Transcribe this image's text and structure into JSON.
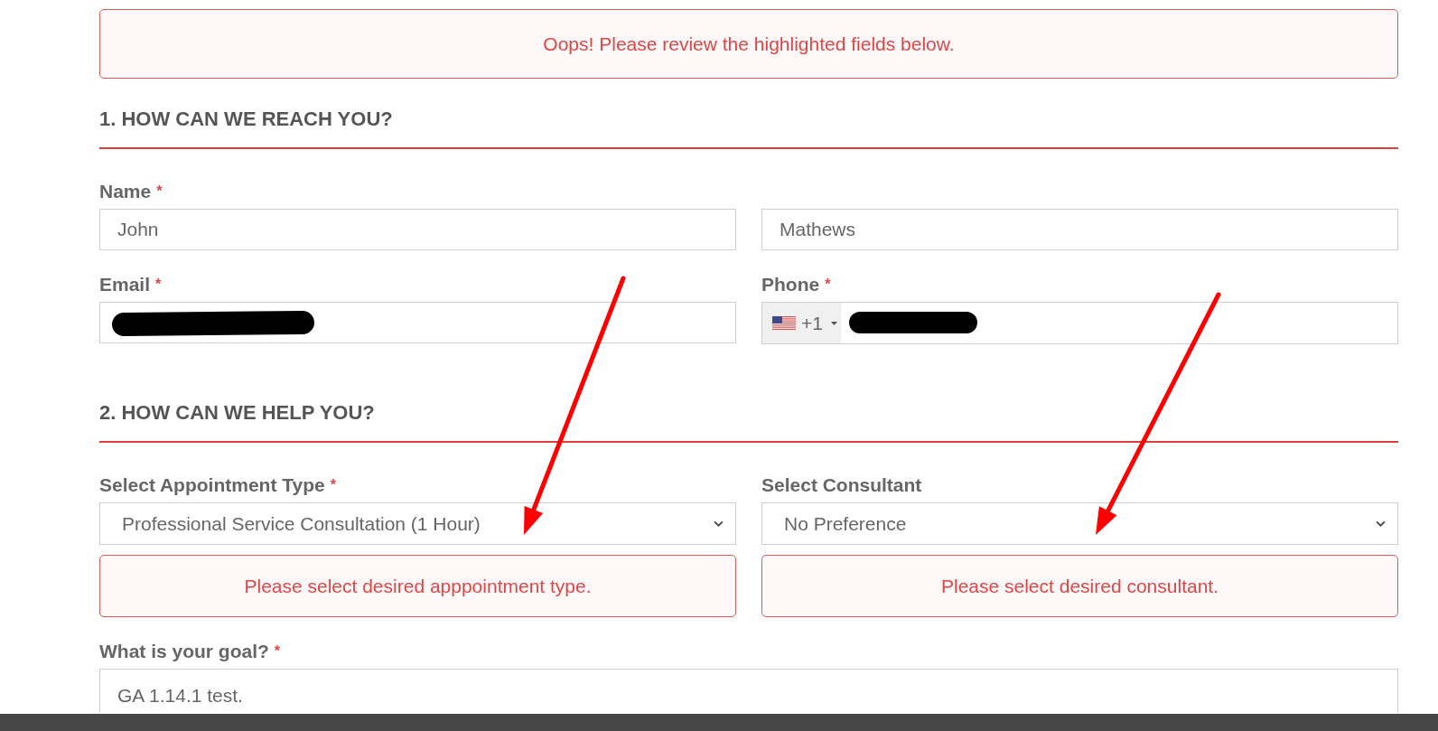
{
  "alert": {
    "message": "Oops! Please review the highlighted fields below."
  },
  "sections": [
    {
      "title": "1. HOW CAN WE REACH YOU?",
      "rows": [
        {
          "fields": [
            {
              "kind": "text",
              "label": "Name",
              "required_marker": "*",
              "value": "John"
            },
            {
              "kind": "text",
              "value": "Mathews"
            }
          ]
        },
        {
          "fields": [
            {
              "kind": "text",
              "label": "Email",
              "required_marker": "*",
              "redacted": true
            },
            {
              "kind": "phone",
              "label": "Phone",
              "required_marker": "*",
              "country_code": "+1",
              "redacted": true
            }
          ]
        }
      ]
    },
    {
      "title": "2. HOW CAN WE HELP YOU?",
      "rows": [
        {
          "fields": [
            {
              "kind": "select",
              "label": "Select Appointment Type",
              "required_marker": "*",
              "value": "Professional Service Consultation (1 Hour)",
              "error": "Please select desired apppointment type."
            },
            {
              "kind": "select",
              "label": "Select Consultant",
              "value": "No Preference",
              "error": "Please select desired consultant."
            }
          ]
        },
        {
          "fields": [
            {
              "kind": "textarea",
              "label": "What is your goal?",
              "required_marker": "*",
              "value": "GA 1.14.1 test."
            }
          ]
        }
      ]
    }
  ]
}
